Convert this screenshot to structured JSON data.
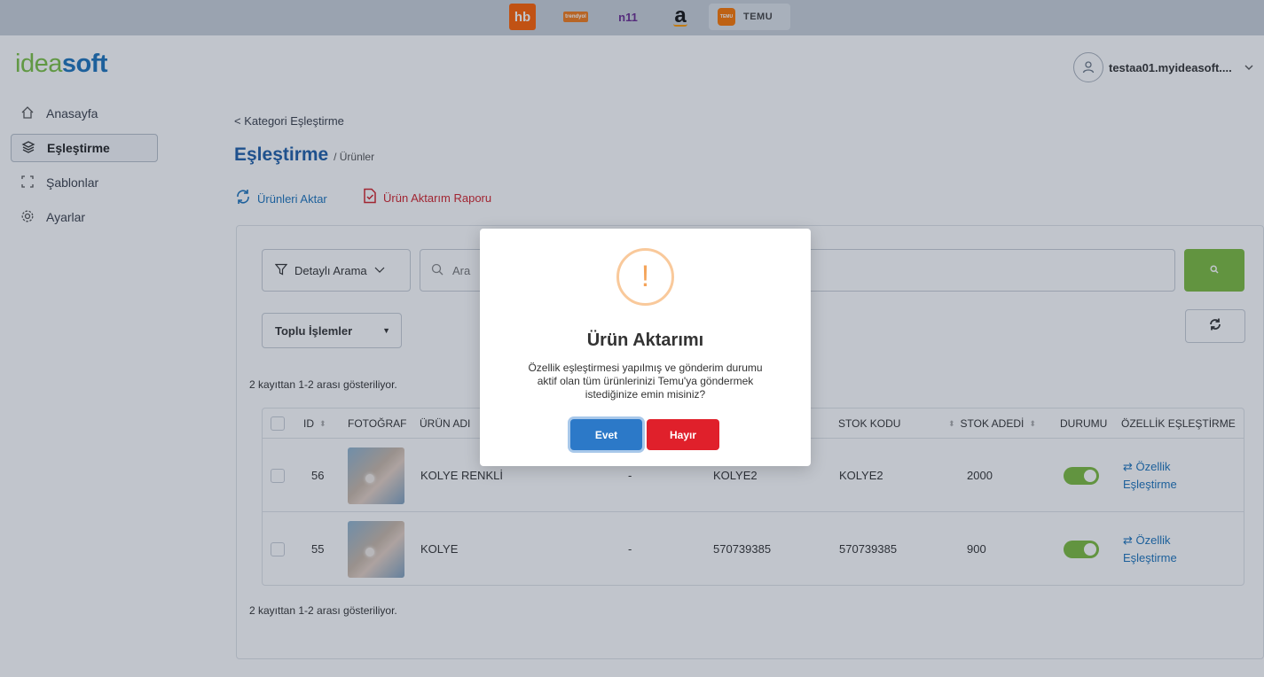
{
  "marketplaces": {
    "hb": "hb",
    "trendyol": "trendyol",
    "n11": "n11",
    "amazon": "a",
    "temu_logo": "TEMU",
    "temu": "TEMU"
  },
  "brand": {
    "part1": "idea",
    "part2": "soft"
  },
  "user": {
    "name": "testaa01.myideasoft...."
  },
  "sidebar": {
    "items": [
      {
        "label": "Anasayfa",
        "icon": "home-icon"
      },
      {
        "label": "Eşleştirme",
        "icon": "layers-icon"
      },
      {
        "label": "Şablonlar",
        "icon": "frame-icon"
      },
      {
        "label": "Ayarlar",
        "icon": "gear-icon"
      }
    ]
  },
  "breadcrumb": "< Kategori Eşleştirme",
  "page": {
    "title": "Eşleştirme",
    "subtitle": "/ Ürünler"
  },
  "actions": {
    "export": "Ürünleri Aktar",
    "report": "Ürün Aktarım Raporu"
  },
  "filter": {
    "label": "Detaylı Arama"
  },
  "search": {
    "placeholder": "Ara"
  },
  "bulk": {
    "label": "Toplu İşlemler"
  },
  "record_count": "2 kayıttan 1-2 arası gösteriliyor.",
  "table": {
    "headers": {
      "id": "ID",
      "photo": "FOTOĞRAF",
      "name": "ÜRÜN ADI",
      "stock_code": "STOK KODU",
      "stock_qty": "STOK ADEDİ",
      "status": "DURUMU",
      "feature_map": "ÖZELLİK EŞLEŞTİRME"
    },
    "rows": [
      {
        "id": "56",
        "name": "KOLYE RENKLİ",
        "col4": "-",
        "barcode": "KOLYE2",
        "stock_code": "KOLYE2",
        "stock_qty": "2000",
        "map1": "⇄ Özellik",
        "map2": "Eşleştirme"
      },
      {
        "id": "55",
        "name": "KOLYE",
        "col4": "-",
        "barcode": "570739385",
        "stock_code": "570739385",
        "stock_qty": "900",
        "map1": "⇄ Özellik",
        "map2": "Eşleştirme"
      }
    ]
  },
  "modal": {
    "icon": "!",
    "title": "Ürün Aktarımı",
    "line1": "Özellik eşleştirmesi yapılmış ve gönderim durumu",
    "line2": "aktif olan tüm ürünlerinizi Temu'ya göndermek",
    "line3": "istediğinize emin misiniz?",
    "yes": "Evet",
    "no": "Hayır"
  },
  "colors": {
    "accent_blue": "#1d74bb",
    "brand_green": "#7ac143",
    "danger_red": "#e0202b",
    "warning_orange": "#f4a45a"
  }
}
